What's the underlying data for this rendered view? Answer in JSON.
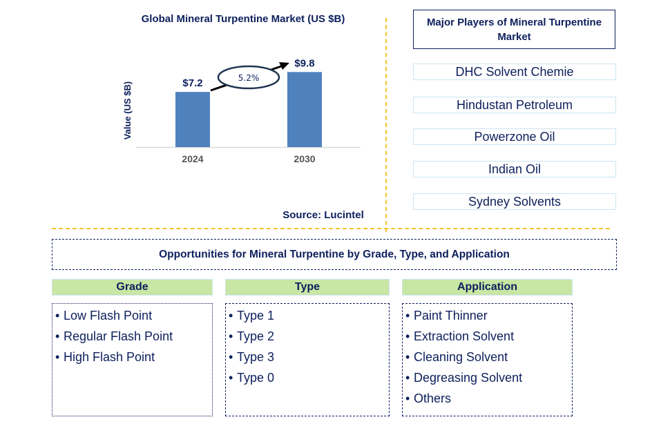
{
  "chart_data": {
    "type": "bar",
    "title": "Global Mineral Turpentine Market (US $B)",
    "xlabel": "",
    "ylabel": "Value (US $B)",
    "categories": [
      "2024",
      "2030"
    ],
    "values": [
      7.2,
      9.8
    ],
    "data_labels": [
      "$7.2",
      "$9.8"
    ],
    "ylim": [
      0,
      11
    ],
    "grid": false,
    "annotation": {
      "type": "cagr-arrow",
      "text": "5.2%"
    },
    "source": "Source: Lucintel",
    "bar_color": "#4f81bd"
  },
  "players": {
    "title": "Major Players of Mineral Turpentine Market",
    "items": [
      "DHC Solvent Chemie",
      "Hindustan Petroleum",
      "Powerzone Oil",
      "Indian Oil",
      "Sydney Solvents"
    ]
  },
  "opportunities": {
    "title": "Opportunities for Mineral Turpentine by Grade, Type, and Application",
    "categories": [
      {
        "heading": "Grade",
        "items": [
          "Low Flash Point",
          "Regular Flash Point",
          "High Flash Point"
        ]
      },
      {
        "heading": "Type",
        "items": [
          "Type 1",
          "Type 2",
          "Type 3",
          "Type 0"
        ]
      },
      {
        "heading": "Application",
        "items": [
          "Paint Thinner",
          "Extraction Solvent",
          "Cleaning Solvent",
          "Degreasing Solvent",
          "Others"
        ]
      }
    ]
  },
  "colors": {
    "text": "#0d1f5c",
    "bar": "#4f81bd",
    "header_fill": "#c8e6a4",
    "separator": "#f6c22a",
    "player_border": "#cde4f2"
  },
  "bullet": "•"
}
